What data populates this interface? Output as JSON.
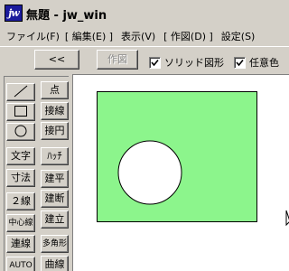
{
  "window": {
    "app_icon_text": "jw",
    "title": "無題 - jw_win"
  },
  "menu": {
    "items": [
      "ファイル(F)",
      "[ 編集(E) ]",
      "表示(V)",
      "[ 作図(D) ]",
      "設定(S)"
    ]
  },
  "toolbar": {
    "back_label": "<<",
    "draw_label": "作図",
    "solid_fill_label": "ソリッド図形",
    "solid_fill_checked": true,
    "any_color_label": "任意色",
    "any_color_checked": true
  },
  "palette": {
    "left": [
      "line-icon",
      "rectangle-icon",
      "circle-icon",
      "文字",
      "寸法",
      "２線",
      "中心線",
      "連線",
      "AUTO"
    ],
    "right": [
      "点",
      "接線",
      "接円",
      "ﾊｯﾁ",
      "建平",
      "建断",
      "建立",
      "多角形",
      "曲線"
    ]
  },
  "canvas": {
    "background": "#ffffff",
    "fill_color": "#8cf58c",
    "circle_fill": "#ffffff",
    "stroke_color": "#000000"
  }
}
